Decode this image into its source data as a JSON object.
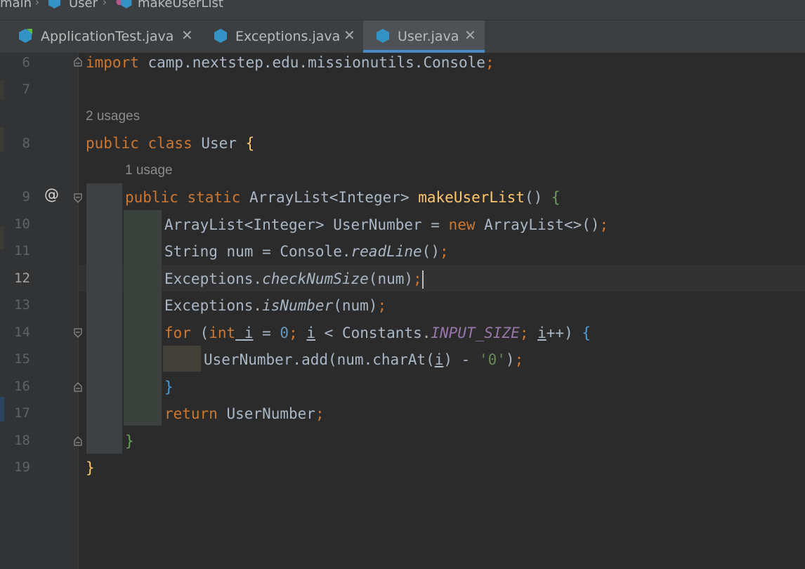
{
  "breadcrumb": {
    "items": [
      "main",
      "User",
      "makeUserList"
    ]
  },
  "tabs": [
    {
      "label": "ApplicationTest.java",
      "active": false
    },
    {
      "label": "Exceptions.java",
      "active": false
    },
    {
      "label": "User.java",
      "active": true
    }
  ],
  "gutter": {
    "line_numbers": [
      "6",
      "7",
      "8",
      "9",
      "10",
      "11",
      "12",
      "13",
      "14",
      "15",
      "16",
      "17",
      "18",
      "19"
    ],
    "override_marker": "@"
  },
  "hints": {
    "class_usages": "2 usages",
    "method_usages": "1 usage"
  },
  "code": {
    "l6": {
      "kw": "import",
      "rest": " camp.nextstep.edu.missionutils.Console",
      "semi": ";"
    },
    "l8": {
      "kw": "public class",
      "name": " User ",
      "brace": "{"
    },
    "l9": {
      "kw": "public static",
      "type": " ArrayList<Integer> ",
      "method": "makeUserList",
      "rest": "() ",
      "brace": "{"
    },
    "l10": {
      "a": "ArrayList<Integer> UserNumber = ",
      "kw": "new",
      "b": " ArrayList<>()",
      "semi": ";"
    },
    "l11": {
      "a": "String num = Console.",
      "call": "readLine",
      "b": "()",
      "semi": ";"
    },
    "l12": {
      "a": "Exceptions.",
      "call": "checkNumSize",
      "b": "(num)",
      "semi": ";"
    },
    "l13": {
      "a": "Exceptions.",
      "call": "isNumber",
      "b": "(num)",
      "semi": ";"
    },
    "l14": {
      "kw": "for",
      "p1": " (",
      "kw2": "int",
      "v1": " i",
      "eq": " = ",
      "zero": "0",
      "s1": "; ",
      "v2": "i",
      "lt": " < Constants.",
      "const": "INPUT_SIZE",
      "s2": "; ",
      "v3": "i",
      "pp": "++) ",
      "brace": "{"
    },
    "l15": {
      "a": "UserNumber.add(num.charAt(",
      "v": "i",
      "b": ") - ",
      "str": "'0'",
      "c": ")",
      "semi": ";"
    },
    "l16": {
      "brace": "}"
    },
    "l17": {
      "kw": "return",
      "rest": " UserNumber",
      "semi": ";"
    },
    "l18": {
      "brace": "}"
    },
    "l19": {
      "brace": "}"
    }
  },
  "colors": {
    "keyword": "#cc7832",
    "function": "#ffc66d",
    "constant": "#9876aa",
    "number": "#6897bb",
    "string": "#6a8759",
    "text": "#a9b7c6"
  }
}
